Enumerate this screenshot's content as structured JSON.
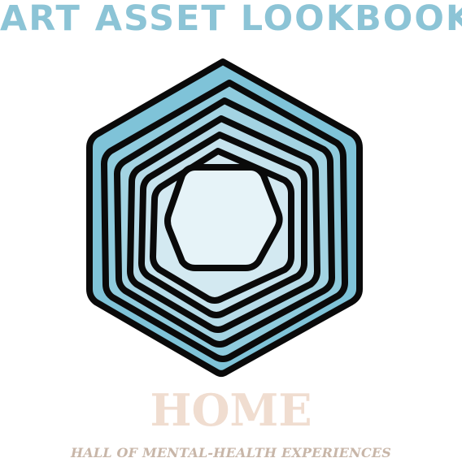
{
  "header": {
    "title": "ART ASSET LOOKBOOK"
  },
  "logo": {
    "icon": "concentric-hexagon-icon",
    "colors": {
      "outer": "#7fc3d8",
      "inner": "#e6f3f8",
      "stroke": "#0a0a0a"
    }
  },
  "footer": {
    "home": "HOME",
    "subtitle": "HALL OF MENTAL-HEALTH EXPERIENCES"
  }
}
